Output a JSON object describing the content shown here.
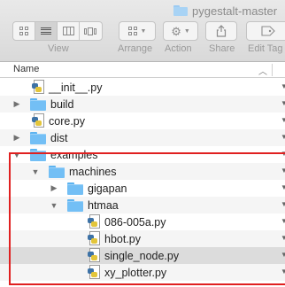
{
  "window": {
    "title": "pygestalt-master"
  },
  "toolbar": {
    "view_label": "View",
    "arrange_label": "Arrange",
    "action_label": "Action",
    "share_label": "Share",
    "edit_tags_label": "Edit Tag"
  },
  "header": {
    "name_label": "Name"
  },
  "files": [
    {
      "name": "__init__.py",
      "type": "py",
      "level": 0,
      "disclosure": ""
    },
    {
      "name": "build",
      "type": "folder",
      "level": 0,
      "disclosure": "collapsed"
    },
    {
      "name": "core.py",
      "type": "py",
      "level": 0,
      "disclosure": ""
    },
    {
      "name": "dist",
      "type": "folder",
      "level": 0,
      "disclosure": "collapsed"
    },
    {
      "name": "examples",
      "type": "folder",
      "level": 0,
      "disclosure": "expanded"
    },
    {
      "name": "machines",
      "type": "folder",
      "level": 1,
      "disclosure": "expanded"
    },
    {
      "name": "gigapan",
      "type": "folder",
      "level": 2,
      "disclosure": "collapsed"
    },
    {
      "name": "htmaa",
      "type": "folder",
      "level": 2,
      "disclosure": "expanded"
    },
    {
      "name": "086-005a.py",
      "type": "py",
      "level": 3,
      "disclosure": ""
    },
    {
      "name": "hbot.py",
      "type": "py",
      "level": 3,
      "disclosure": ""
    },
    {
      "name": "single_node.py",
      "type": "py",
      "level": 3,
      "disclosure": "",
      "selected": true
    },
    {
      "name": "xy_plotter.py",
      "type": "py",
      "level": 3,
      "disclosure": ""
    }
  ],
  "icons": {
    "folder": "folder-icon",
    "python_file": "python-file-icon",
    "disclosure_collapsed": "disclosure-triangle-right-icon",
    "disclosure_expanded": "disclosure-triangle-down-icon"
  },
  "colors": {
    "highlight_box": "#e02020",
    "folder": "#73bff5",
    "selected_row": "#dcdcdc"
  }
}
